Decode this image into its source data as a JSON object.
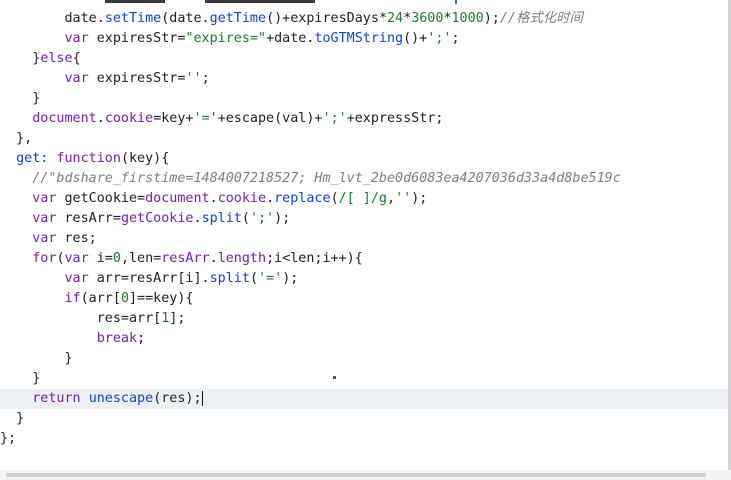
{
  "editor": {
    "lines": [
      {
        "tokens": [
          {
            "t": "        "
          },
          {
            "t": "date.",
            "c": "tx"
          },
          {
            "t": "setTime",
            "c": "fn"
          },
          {
            "t": "(date.",
            "c": "tx"
          },
          {
            "t": "getTime",
            "c": "fn"
          },
          {
            "t": "()+expiresDays*",
            "c": "tx"
          },
          {
            "t": "24",
            "c": "num"
          },
          {
            "t": "*",
            "c": "tx"
          },
          {
            "t": "3600",
            "c": "num"
          },
          {
            "t": "*",
            "c": "tx"
          },
          {
            "t": "1000",
            "c": "num"
          },
          {
            "t": ");",
            "c": "tx"
          },
          {
            "t": "//格式化时间",
            "c": "cm"
          }
        ]
      },
      {
        "tokens": [
          {
            "t": "        "
          },
          {
            "t": "var",
            "c": "kw"
          },
          {
            "t": " expiresStr=",
            "c": "tx"
          },
          {
            "t": "\"expires=\"",
            "c": "str"
          },
          {
            "t": "+date.",
            "c": "tx"
          },
          {
            "t": "toGTMString",
            "c": "fn"
          },
          {
            "t": "()+",
            "c": "tx"
          },
          {
            "t": "';'",
            "c": "str"
          },
          {
            "t": ";",
            "c": "tx"
          }
        ]
      },
      {
        "tokens": [
          {
            "t": "    "
          },
          {
            "t": "}",
            "c": "tx"
          },
          {
            "t": "else",
            "c": "kw"
          },
          {
            "t": "{",
            "c": "tx"
          }
        ]
      },
      {
        "tokens": [
          {
            "t": "        "
          },
          {
            "t": "var",
            "c": "kw"
          },
          {
            "t": " expiresStr=",
            "c": "tx"
          },
          {
            "t": "''",
            "c": "str"
          },
          {
            "t": ";",
            "c": "tx"
          }
        ]
      },
      {
        "tokens": [
          {
            "t": "    "
          },
          {
            "t": "}",
            "c": "tx"
          }
        ]
      },
      {
        "tokens": [
          {
            "t": "    "
          },
          {
            "t": "document",
            "c": "kw"
          },
          {
            "t": ".",
            "c": "tx"
          },
          {
            "t": "cookie",
            "c": "kw"
          },
          {
            "t": "=key+",
            "c": "tx"
          },
          {
            "t": "'='",
            "c": "str"
          },
          {
            "t": "+escape(val)+",
            "c": "tx"
          },
          {
            "t": "';'",
            "c": "str"
          },
          {
            "t": "+expressStr;",
            "c": "tx"
          }
        ]
      },
      {
        "tokens": [
          {
            "t": "  "
          },
          {
            "t": "},",
            "c": "tx"
          }
        ]
      },
      {
        "tokens": [
          {
            "t": "  "
          },
          {
            "t": "get:",
            "c": "fn"
          },
          {
            "t": " ",
            "c": "tx"
          },
          {
            "t": "function",
            "c": "kw"
          },
          {
            "t": "(key){",
            "c": "tx"
          }
        ]
      },
      {
        "tokens": [
          {
            "t": "    "
          },
          {
            "t": "//\"bdshare_firstime=1484007218527; Hm_lvt_2be0d6083ea4207036d33a4d8be519c",
            "c": "cm"
          }
        ]
      },
      {
        "tokens": [
          {
            "t": "    "
          },
          {
            "t": "var",
            "c": "kw"
          },
          {
            "t": " getCookie=",
            "c": "tx"
          },
          {
            "t": "document",
            "c": "kw"
          },
          {
            "t": ".",
            "c": "tx"
          },
          {
            "t": "cookie",
            "c": "kw"
          },
          {
            "t": ".",
            "c": "tx"
          },
          {
            "t": "replace",
            "c": "fn"
          },
          {
            "t": "(",
            "c": "tx"
          },
          {
            "t": "/[ ]/g",
            "c": "str"
          },
          {
            "t": ",",
            "c": "tx"
          },
          {
            "t": "''",
            "c": "str"
          },
          {
            "t": ");",
            "c": "tx"
          }
        ]
      },
      {
        "tokens": [
          {
            "t": "    "
          },
          {
            "t": "var",
            "c": "kw"
          },
          {
            "t": " resArr=",
            "c": "tx"
          },
          {
            "t": "getCookie",
            "c": "kw"
          },
          {
            "t": ".",
            "c": "tx"
          },
          {
            "t": "split",
            "c": "fn"
          },
          {
            "t": "(",
            "c": "tx"
          },
          {
            "t": "';'",
            "c": "str"
          },
          {
            "t": ");",
            "c": "tx"
          }
        ]
      },
      {
        "tokens": [
          {
            "t": "    "
          },
          {
            "t": "var",
            "c": "kw"
          },
          {
            "t": " res;",
            "c": "tx"
          }
        ]
      },
      {
        "tokens": [
          {
            "t": "    "
          },
          {
            "t": "for",
            "c": "kw"
          },
          {
            "t": "(",
            "c": "tx"
          },
          {
            "t": "var",
            "c": "kw"
          },
          {
            "t": " i=",
            "c": "tx"
          },
          {
            "t": "0",
            "c": "num"
          },
          {
            "t": ",len=",
            "c": "tx"
          },
          {
            "t": "resArr",
            "c": "kw"
          },
          {
            "t": ".",
            "c": "tx"
          },
          {
            "t": "length",
            "c": "kw"
          },
          {
            "t": ";i<len;i++){",
            "c": "tx"
          }
        ]
      },
      {
        "tokens": [
          {
            "t": "        "
          },
          {
            "t": "var",
            "c": "kw"
          },
          {
            "t": " arr=resArr[i].",
            "c": "tx"
          },
          {
            "t": "split",
            "c": "fn"
          },
          {
            "t": "(",
            "c": "tx"
          },
          {
            "t": "'='",
            "c": "str"
          },
          {
            "t": ");",
            "c": "tx"
          }
        ]
      },
      {
        "tokens": [
          {
            "t": "        "
          },
          {
            "t": "if",
            "c": "kw"
          },
          {
            "t": "(arr[",
            "c": "tx"
          },
          {
            "t": "0",
            "c": "num"
          },
          {
            "t": "]==key){",
            "c": "tx"
          }
        ]
      },
      {
        "tokens": [
          {
            "t": "            "
          },
          {
            "t": "res=arr[",
            "c": "tx"
          },
          {
            "t": "1",
            "c": "num"
          },
          {
            "t": "];",
            "c": "tx"
          }
        ]
      },
      {
        "tokens": [
          {
            "t": "            "
          },
          {
            "t": "break",
            "c": "kw"
          },
          {
            "t": ";",
            "c": "tx"
          }
        ]
      },
      {
        "tokens": [
          {
            "t": "        "
          },
          {
            "t": "}",
            "c": "tx"
          }
        ]
      },
      {
        "tokens": [
          {
            "t": "    "
          },
          {
            "t": "}",
            "c": "tx"
          }
        ]
      },
      {
        "current": true,
        "tokens": [
          {
            "t": "    "
          },
          {
            "t": "return",
            "c": "kw"
          },
          {
            "t": " ",
            "c": "tx"
          },
          {
            "t": "unescape",
            "c": "fn"
          },
          {
            "t": "(res);",
            "c": "tx"
          }
        ]
      },
      {
        "tokens": [
          {
            "t": "  "
          },
          {
            "t": "}",
            "c": "tx"
          }
        ]
      },
      {
        "tokens": [
          {
            "t": "};",
            "c": "tx"
          }
        ]
      }
    ]
  }
}
